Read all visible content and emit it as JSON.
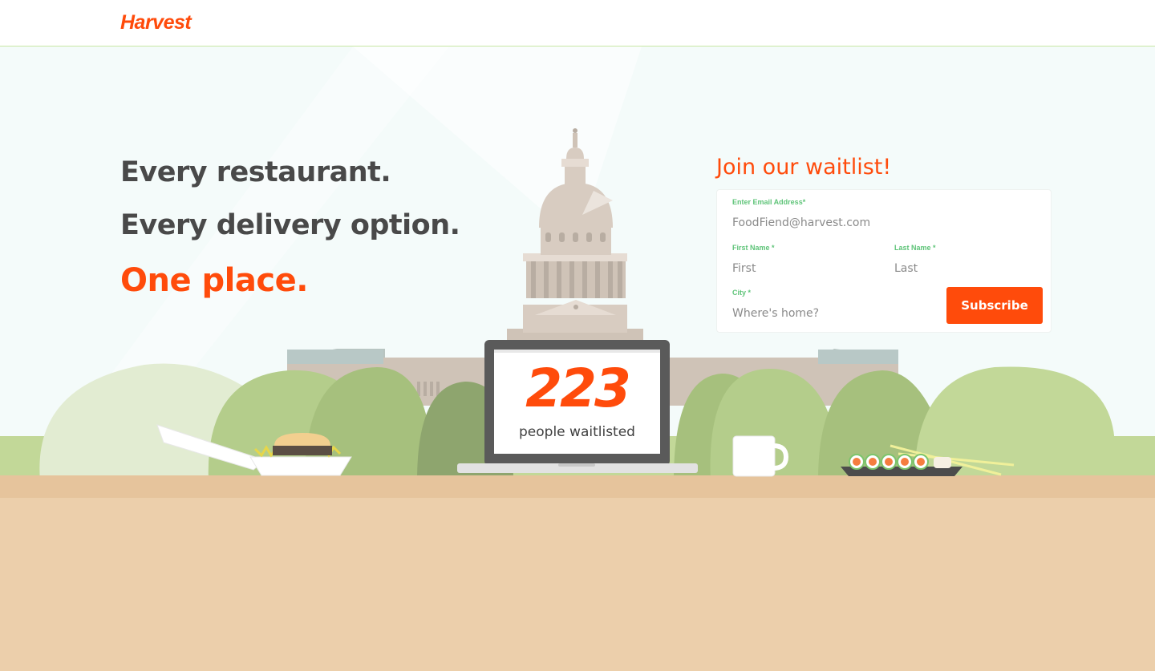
{
  "header": {
    "logo_text": "Harvest"
  },
  "hero": {
    "line1": "Every restaurant.",
    "line2": "Every delivery option.",
    "line3": "One place."
  },
  "waitlist": {
    "title": "Join our waitlist!",
    "email_label": "Enter Email Address*",
    "email_placeholder": "FoodFiend@harvest.com",
    "first_name_label": "First Name *",
    "first_name_placeholder": "First",
    "last_name_label": "Last Name *",
    "last_name_placeholder": "Last",
    "city_label": "City *",
    "city_placeholder": "Where's home?",
    "subscribe_label": "Subscribe"
  },
  "counter": {
    "count": "223",
    "label": "people waitlisted"
  },
  "colors": {
    "brand": "#ff4b0b",
    "label_green": "#5fc479",
    "headline_gray": "#494949",
    "table_tan": "#eccfab"
  }
}
